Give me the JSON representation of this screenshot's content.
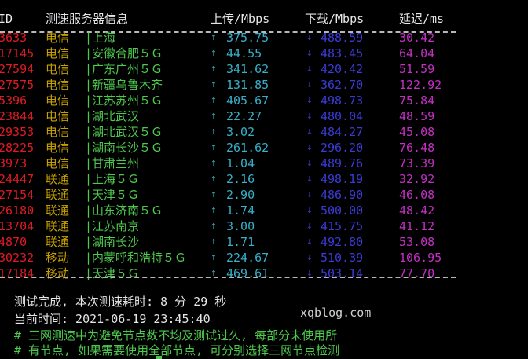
{
  "header": {
    "id": "ID",
    "node": "测速服务器信息",
    "upload": "上传/Mbps",
    "download": "下载/Mbps",
    "latency": "延迟/ms"
  },
  "icons": {
    "up": "up-arrow-icon",
    "down": "down-arrow-icon"
  },
  "colors": {
    "id": "#e01b24",
    "isp": "#c4a000",
    "city": "#4ec94e",
    "upload": "#37b0c8",
    "download": "#3b3bd6",
    "latency": "#c330c3"
  },
  "up_glyph": "↑",
  "down_glyph": "↓",
  "rows": [
    {
      "id": "3633",
      "isp": "电信",
      "city": "|上海",
      "up": "375.75",
      "down": "488.59",
      "lat": "30.42"
    },
    {
      "id": "17145",
      "isp": "电信",
      "city": "|安徽合肥５Ｇ",
      "up": "44.55",
      "down": "483.45",
      "lat": "64.04"
    },
    {
      "id": "27594",
      "isp": "电信",
      "city": "|广东广州５Ｇ",
      "up": "341.62",
      "down": "420.42",
      "lat": "51.59"
    },
    {
      "id": "27575",
      "isp": "电信",
      "city": "|新疆乌鲁木齐",
      "up": "131.85",
      "down": "362.70",
      "lat": "122.92"
    },
    {
      "id": "5396",
      "isp": "电信",
      "city": "|江苏苏州５Ｇ",
      "up": "405.67",
      "down": "498.73",
      "lat": "75.84"
    },
    {
      "id": "23844",
      "isp": "电信",
      "city": "|湖北武汉",
      "up": "22.27",
      "down": "480.04",
      "lat": "48.59"
    },
    {
      "id": "29353",
      "isp": "电信",
      "city": "|湖北武汉５Ｇ",
      "up": "3.02",
      "down": "484.27",
      "lat": "45.08"
    },
    {
      "id": "28225",
      "isp": "电信",
      "city": "|湖南长沙５Ｇ",
      "up": "261.62",
      "down": "296.20",
      "lat": "76.48"
    },
    {
      "id": "3973",
      "isp": "电信",
      "city": "|甘肃兰州",
      "up": "1.04",
      "down": "489.76",
      "lat": "73.39"
    },
    {
      "id": "24447",
      "isp": "联通",
      "city": "|上海５Ｇ",
      "up": "2.16",
      "down": "498.19",
      "lat": "32.92"
    },
    {
      "id": "27154",
      "isp": "联通",
      "city": "|天津５Ｇ",
      "up": "2.90",
      "down": "486.90",
      "lat": "46.08"
    },
    {
      "id": "26180",
      "isp": "联通",
      "city": "|山东济南５Ｇ",
      "up": "1.74",
      "down": "500.00",
      "lat": "48.42"
    },
    {
      "id": "13704",
      "isp": "联通",
      "city": "|江苏南京",
      "up": "3.00",
      "down": "415.75",
      "lat": "41.12"
    },
    {
      "id": "4870",
      "isp": "联通",
      "city": "|湖南长沙",
      "up": "1.71",
      "down": "492.80",
      "lat": "53.08"
    },
    {
      "id": "30232",
      "isp": "移动",
      "city": "|内蒙呼和浩特５Ｇ",
      "up": "224.67",
      "down": "510.39",
      "lat": "106.95"
    },
    {
      "id": "17184",
      "isp": "移动",
      "city": "|天津５Ｇ",
      "up": "469.61",
      "down": "503.14",
      "lat": "77.70"
    }
  ],
  "footer": {
    "done": "测试完成, 本次测速耗时: 8 分 29 秒",
    "time": "当前时间: 2021-06-19 23:45:40",
    "note1": "# 三网测速中为避免节点数不均及测试过久, 每部分未使用所",
    "note2": "# 有节点, 如果需要使用全部节点, 可分别选择三网节点检测"
  },
  "watermark": "xqblog.com"
}
